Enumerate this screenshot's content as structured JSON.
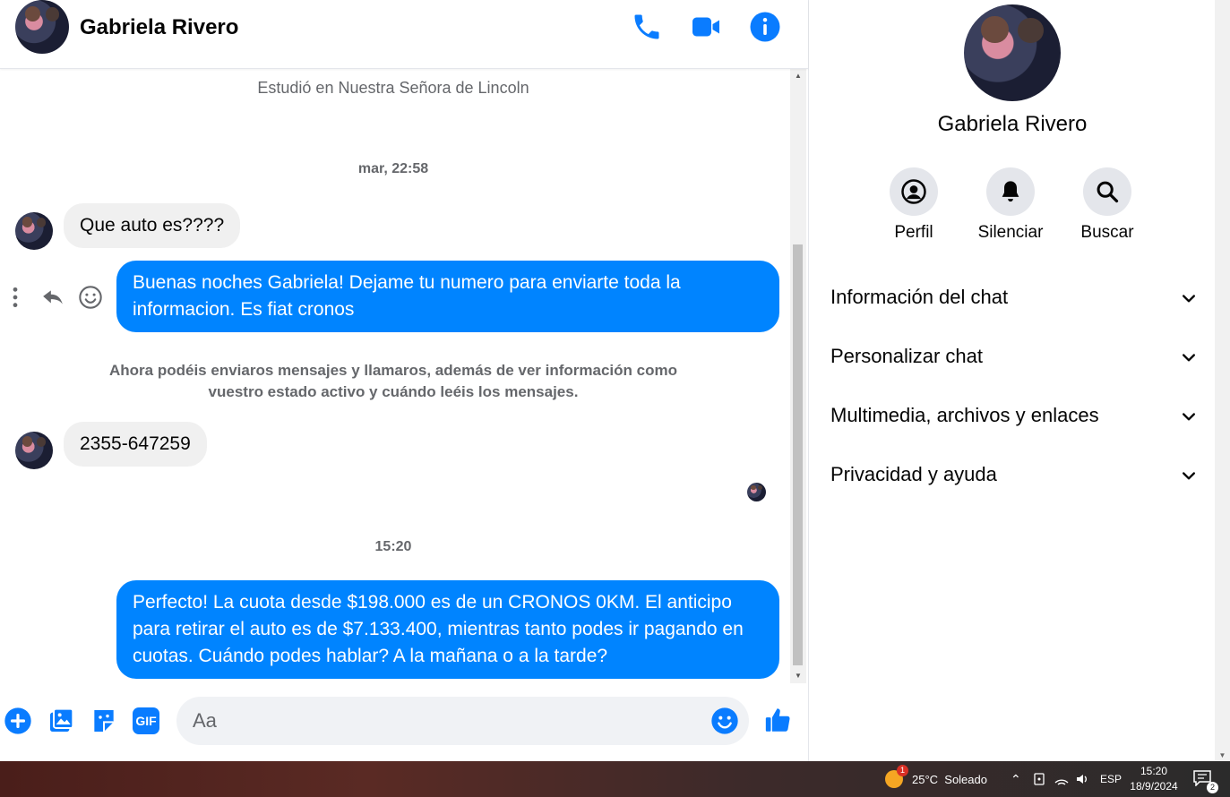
{
  "header": {
    "title": "Gabriela Rivero"
  },
  "messages": {
    "partial_line": "",
    "study_line": "Estudió en Nuestra Señora de Lincoln",
    "timestamp1": "mar, 22:58",
    "in1": "Que auto es????",
    "out1": "Buenas noches Gabriela! Dejame tu numero para enviarte toda la informacion. Es fiat cronos",
    "notice": "Ahora podéis enviaros mensajes y llamaros, además de ver información como vuestro estado activo y cuándo leéis los mensajes.",
    "in2": "2355-647259",
    "timestamp2": "15:20",
    "out2": "Perfecto! La cuota desde $198.000 es de un CRONOS 0KM. El anticipo para retirar el auto es de $7.133.400, mientras tanto podes ir pagando en cuotas. Cuándo podes hablar? A la mañana o a la tarde?"
  },
  "composer": {
    "placeholder": "Aa",
    "gif_label": "GIF"
  },
  "sidebar": {
    "name": "Gabriela Rivero",
    "actions": [
      {
        "label": "Perfil"
      },
      {
        "label": "Silenciar"
      },
      {
        "label": "Buscar"
      }
    ],
    "sections": [
      {
        "title": "Información del chat"
      },
      {
        "title": "Personalizar chat"
      },
      {
        "title": "Multimedia, archivos y enlaces"
      },
      {
        "title": "Privacidad y ayuda"
      }
    ]
  },
  "taskbar": {
    "weather_badge": "1",
    "weather": "25°C  Soleado",
    "lang": "ESP",
    "time": "15:20",
    "date": "18/9/2024",
    "notif_count": "2"
  },
  "colors": {
    "accent": "#0084ff",
    "incoming": "#f0f0f0",
    "icon_blue": "#0a7cff"
  }
}
